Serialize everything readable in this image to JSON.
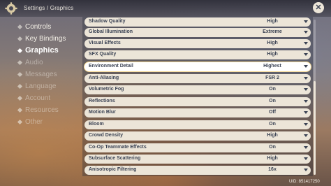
{
  "header": {
    "breadcrumb": "Settings / Graphics",
    "gear_icon": "gear-icon",
    "close_icon": "close-icon",
    "close_glyph": "✕"
  },
  "sidebar": {
    "items": [
      {
        "label": "Controls"
      },
      {
        "label": "Key Bindings"
      },
      {
        "label": "Graphics"
      },
      {
        "label": "Audio"
      },
      {
        "label": "Messages"
      },
      {
        "label": "Language"
      },
      {
        "label": "Account"
      },
      {
        "label": "Resources"
      },
      {
        "label": "Other"
      }
    ]
  },
  "settings": {
    "rows": [
      {
        "label": "Shadow Quality",
        "value": "High"
      },
      {
        "label": "Global Illumination",
        "value": "Extreme"
      },
      {
        "label": "Visual Effects",
        "value": "High"
      },
      {
        "label": "SFX Quality",
        "value": "High"
      },
      {
        "label": "Environment Detail",
        "value": "Highest"
      },
      {
        "label": "Anti-Aliasing",
        "value": "FSR 2"
      },
      {
        "label": "Volumetric Fog",
        "value": "On"
      },
      {
        "label": "Reflections",
        "value": "On"
      },
      {
        "label": "Motion Blur",
        "value": "Off"
      },
      {
        "label": "Bloom",
        "value": "On"
      },
      {
        "label": "Crowd Density",
        "value": "High"
      },
      {
        "label": "Co-Op Teammate Effects",
        "value": "On"
      },
      {
        "label": "Subsurface Scattering",
        "value": "High"
      },
      {
        "label": "Anisotropic Filtering",
        "value": "16x"
      }
    ]
  },
  "footer": {
    "uid": "UID: 851417250"
  },
  "colors": {
    "row_bg": "#ece5d8",
    "row_text": "#3b4354",
    "highlight_border": "#f6d992"
  }
}
